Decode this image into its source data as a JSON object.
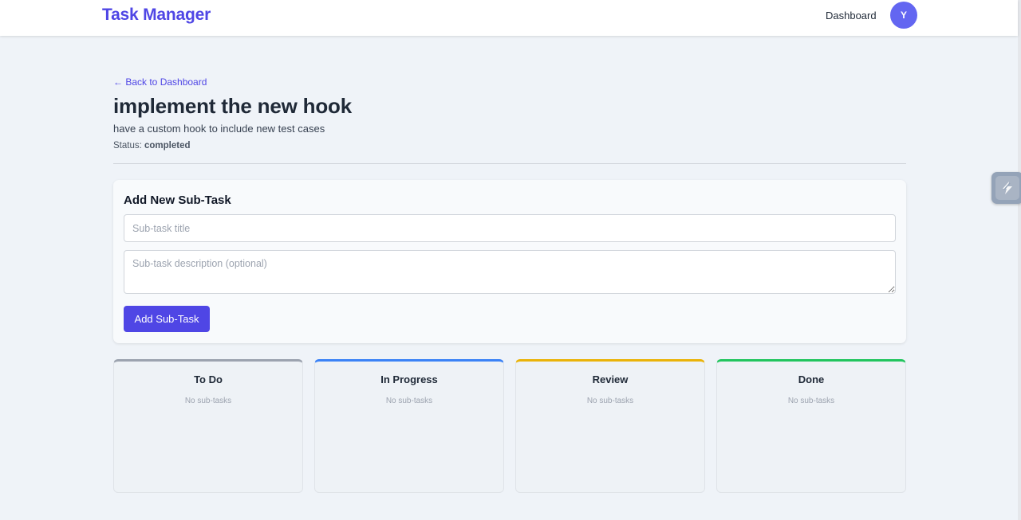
{
  "header": {
    "brand": "Task Manager",
    "nav_dashboard": "Dashboard",
    "avatar_initial": "Y"
  },
  "task": {
    "back_link": "← Back to Dashboard",
    "title": "implement the new hook",
    "description": "have a custom hook to include new test cases",
    "status_label": "Status:",
    "status_value": "completed"
  },
  "form": {
    "heading": "Add New Sub-Task",
    "title_placeholder": "Sub-task title",
    "description_placeholder": "Sub-task description (optional)",
    "submit_label": "Add Sub-Task"
  },
  "board": {
    "columns": [
      {
        "title": "To Do",
        "empty_text": "No sub-tasks",
        "accent": "#9ca3af"
      },
      {
        "title": "In Progress",
        "empty_text": "No sub-tasks",
        "accent": "#3b82f6"
      },
      {
        "title": "Review",
        "empty_text": "No sub-tasks",
        "accent": "#eab308"
      },
      {
        "title": "Done",
        "empty_text": "No sub-tasks",
        "accent": "#22c55e"
      }
    ]
  },
  "theme": {
    "primary": "#4f46e5",
    "avatar_bg": "#6366f1",
    "page_bg": "#eff3f8"
  },
  "extension": {
    "icon": "lightning-bolt-icon"
  }
}
